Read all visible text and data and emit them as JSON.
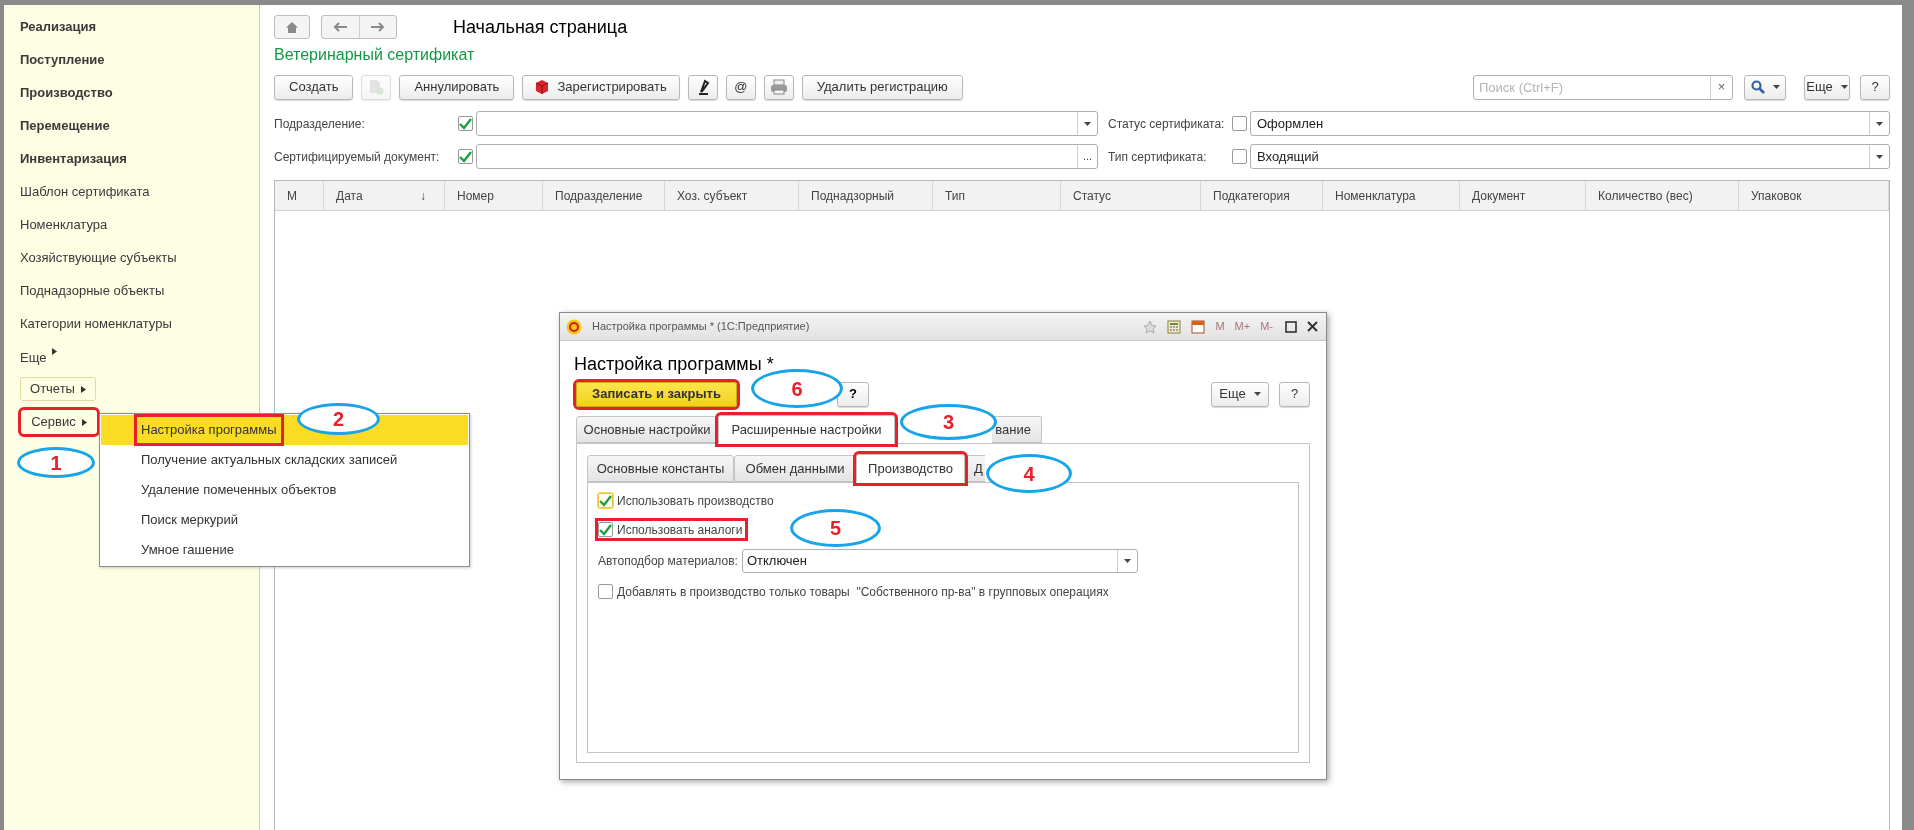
{
  "sidebar": {
    "items": [
      {
        "label": "Реализация",
        "bold": true
      },
      {
        "label": "Поступление",
        "bold": true
      },
      {
        "label": "Производство",
        "bold": true
      },
      {
        "label": "Перемещение",
        "bold": true
      },
      {
        "label": "Инвентаризация",
        "bold": true
      },
      {
        "label": "Шаблон сертификата",
        "bold": false
      },
      {
        "label": "Номенклатура",
        "bold": false
      },
      {
        "label": "Хозяйствующие субъекты",
        "bold": false
      },
      {
        "label": "Поднадзорные объекты",
        "bold": false
      },
      {
        "label": "Категории номенклатуры",
        "bold": false
      }
    ],
    "more": "Еще",
    "buttons": [
      {
        "label": "Отчеты",
        "framed": true,
        "highlighted": false
      },
      {
        "label": "Сервис",
        "framed": false,
        "highlighted": true
      }
    ]
  },
  "service_menu": {
    "items": [
      {
        "label": "Настройка программы",
        "selected": true,
        "highlighted": true
      },
      {
        "label": "Получение актуальных складских записей",
        "selected": false,
        "highlighted": false
      },
      {
        "label": "Удаление помеченных объектов",
        "selected": false,
        "highlighted": false
      },
      {
        "label": "Поиск меркурий",
        "selected": false,
        "highlighted": false
      },
      {
        "label": "Умное гашение",
        "selected": false,
        "highlighted": false
      }
    ]
  },
  "nav": {
    "title": "Начальная страница"
  },
  "form": {
    "title": "Ветеринарный сертификат",
    "toolbar": [
      {
        "kind": "text",
        "label": "Создать"
      },
      {
        "kind": "icon",
        "disabled": true
      },
      {
        "kind": "text",
        "label": "Аннулировать"
      },
      {
        "kind": "icon_text",
        "label": "Зарегистрировать"
      },
      {
        "kind": "icon",
        "disabled": false
      },
      {
        "kind": "text",
        "label": "@"
      },
      {
        "kind": "icon",
        "disabled": false
      },
      {
        "kind": "text",
        "label": "Удалить регистрацию"
      }
    ],
    "search": {
      "placeholder": "Поиск (Ctrl+F)",
      "clear": "×"
    },
    "more_button": "Еще",
    "help_button": "?"
  },
  "filters": [
    {
      "label": "Подразделение:",
      "checked": true,
      "kind": "dropdown"
    },
    {
      "label": "Статус сертификата:",
      "checked": false,
      "value": "Оформлен",
      "kind": "dropdown"
    },
    {
      "label": "Сертифицируемый документ:",
      "checked": true,
      "kind": "select",
      "button_text": "..."
    },
    {
      "label": "Тип сертификата:",
      "checked": false,
      "value": "Входящий",
      "kind": "dropdown"
    }
  ],
  "table": {
    "columns": [
      {
        "label": "М"
      },
      {
        "label": "Дата",
        "sort_mark": "↓"
      },
      {
        "label": "Номер"
      },
      {
        "label": "Подразделение"
      },
      {
        "label": "Хоз. субъект"
      },
      {
        "label": "Поднадзорный"
      },
      {
        "label": "Тип"
      },
      {
        "label": "Статус"
      },
      {
        "label": "Подкатегория"
      },
      {
        "label": "Номенклатура"
      },
      {
        "label": "Документ"
      },
      {
        "label": "Количество (вес)"
      },
      {
        "label": "Упаковок"
      }
    ]
  },
  "dialog": {
    "window_title": "Настройка программы * (1С:Предприятие)",
    "memory_buttons": [
      "M",
      "M+",
      "M-"
    ],
    "heading": "Настройка программы *",
    "save_button": "Записать и закрыть",
    "save_highlighted": true,
    "help_button": "?",
    "more_button": "Еще",
    "help_button_right": "?",
    "tabs": [
      {
        "label": "Основные настройки",
        "selected": false,
        "highlighted": false
      },
      {
        "label": "Расширенные настройки",
        "selected": true,
        "highlighted": true
      },
      {
        "label": "вание",
        "selected": false,
        "highlighted": false
      }
    ],
    "subtabs": [
      {
        "label": "Основные константы",
        "selected": false,
        "highlighted": false
      },
      {
        "label": "Обмен данными",
        "selected": false,
        "highlighted": false
      },
      {
        "label": "Производство",
        "selected": true,
        "highlighted": true
      },
      {
        "label": "Д",
        "selected": false,
        "highlighted": false
      }
    ],
    "options": [
      {
        "kind": "checkbox",
        "label": "Использовать производство",
        "checked": true,
        "focused": true,
        "highlighted": false
      },
      {
        "kind": "checkbox",
        "label": "Использовать аналоги",
        "checked": true,
        "focused": false,
        "highlighted": true
      },
      {
        "kind": "select",
        "label": "Автоподбор материалов:",
        "value": "Отключен"
      },
      {
        "kind": "checkbox",
        "label": "Добавлять в производство только товары  \"Собственного пр-ва\" в групповых операциях",
        "checked": false,
        "focused": false,
        "highlighted": false
      }
    ]
  },
  "callouts": [
    "1",
    "2",
    "3",
    "4",
    "5",
    "6"
  ]
}
